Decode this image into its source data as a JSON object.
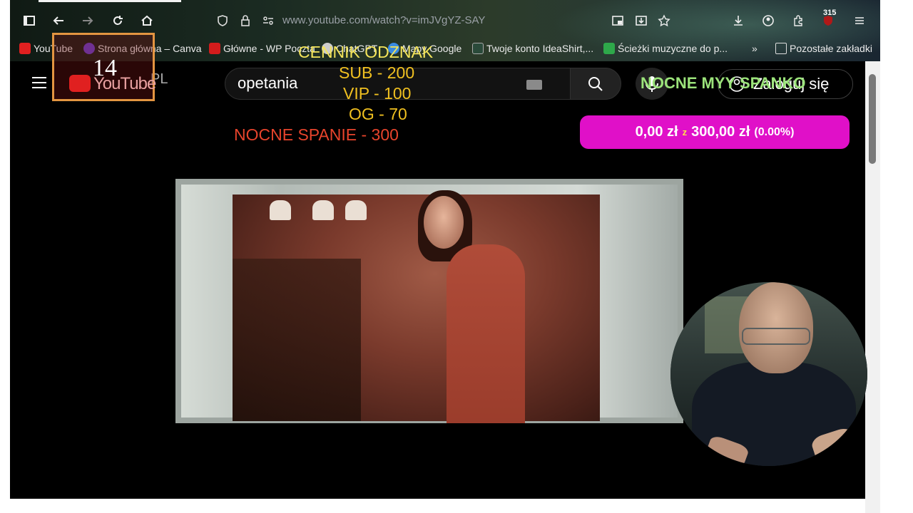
{
  "browser": {
    "url": "www.youtube.com/watch?v=imJVgYZ-SAY",
    "downloads_badge": "315",
    "bookmarks": [
      {
        "label": "YouTube",
        "icon": "youtube-icon"
      },
      {
        "label": "Strona główna – Canva",
        "icon": "canva-icon"
      },
      {
        "label": "Główne - WP Poczta",
        "icon": "wp-icon"
      },
      {
        "label": "ChatGPT",
        "icon": "chatgpt-icon"
      },
      {
        "label": "Mapy Google",
        "icon": "maps-icon"
      },
      {
        "label": "Twoje konto IdeaShirt,...",
        "icon": "ideashirt-icon"
      },
      {
        "label": "Ścieżki muzyczne do p...",
        "icon": "pixabay-icon"
      }
    ],
    "other_bookmarks": "Pozostałe zakładki"
  },
  "youtube": {
    "country_code": "PL",
    "logo_text": "YouTube",
    "search_value": "opetania",
    "signin_label": "Zaloguj się"
  },
  "overlay": {
    "badge_number": "14",
    "price_title": "CENNIK ODZNAK",
    "prices": {
      "sub": "SUB - 200",
      "vip": "VIP - 100",
      "og": "OG - 70",
      "nocne": "NOCNE SPANIE - 300"
    },
    "nocne_label": "NOCNE MYY SPANKO",
    "goal": {
      "current": "0,00 zł",
      "separator": "z",
      "target": "300,00 zł",
      "percent": "(0.00%)",
      "progress": 0
    }
  },
  "colors": {
    "goal_bar": "#e010c8",
    "price_text": "#f0c020",
    "nocne_price": "#e8442c",
    "nocne_overlay": "#9be37a",
    "badge_border": "#e39541"
  }
}
